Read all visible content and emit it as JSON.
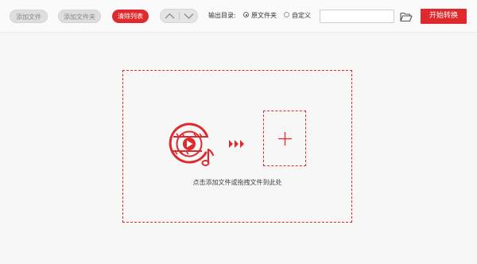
{
  "toolbar": {
    "add_file_label": "添加文件",
    "add_folder_label": "添加文件夹",
    "clear_list_label": "清除列表",
    "move_up_icon": "chevron-up-icon",
    "move_down_icon": "chevron-down-icon",
    "output_dir_label": "输出目录:",
    "output_options": [
      {
        "label": "原文件夹",
        "selected": true
      },
      {
        "label": "自定义",
        "selected": false
      }
    ],
    "output_path_value": "",
    "browse_icon": "folder-open-icon",
    "start_label": "开始转换"
  },
  "drop_zone": {
    "media_icon": "media-file-icon",
    "arrow_icon": "triple-arrow-icon",
    "add_icon": "plus-icon",
    "hint": "点击添加文件或拖拽文件到此处"
  },
  "colors": {
    "accent": "#e0292d",
    "background": "#f7f7f7",
    "disabled_button": "#dedede"
  }
}
